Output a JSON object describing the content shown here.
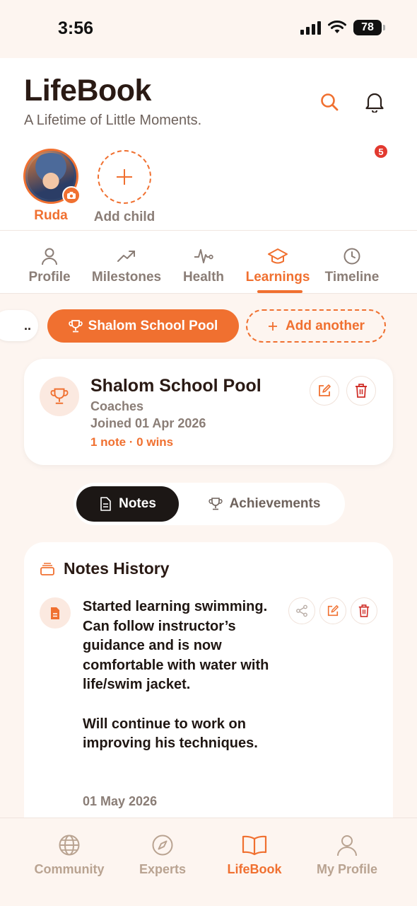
{
  "status_bar": {
    "time": "3:56",
    "battery": "78"
  },
  "header": {
    "title": "LifeBook",
    "subtitle": "A Lifetime of Little Moments.",
    "notification_count": "5"
  },
  "children": {
    "selected_name": "Ruda",
    "add_label": "Add child"
  },
  "tabs": [
    {
      "label": "Profile",
      "icon": "person-icon"
    },
    {
      "label": "Milestones",
      "icon": "trend-icon"
    },
    {
      "label": "Health",
      "icon": "pulse-icon"
    },
    {
      "label": "Learnings",
      "icon": "graduation-cap-icon",
      "active": true
    },
    {
      "label": "Timeline",
      "icon": "clock-icon"
    }
  ],
  "chips": {
    "more": "..",
    "active": "Shalom School Pool",
    "add": "Add another"
  },
  "club": {
    "name": "Shalom School Pool",
    "role": "Coaches",
    "joined": "Joined 01 Apr 2026",
    "stats": "1 note · 0 wins"
  },
  "segment": {
    "notes": "Notes",
    "achievements": "Achievements"
  },
  "notes": {
    "title": "Notes History",
    "items": [
      {
        "text": "Started learning swimming. Can follow instructor’s guidance and is now comfortable with water with life/swim jacket.\n\nWill continue to work on improving his techniques.",
        "date": "01 May 2026"
      }
    ]
  },
  "bottom_nav": [
    {
      "label": "Community",
      "icon": "globe-icon"
    },
    {
      "label": "Experts",
      "icon": "compass-icon"
    },
    {
      "label": "LifeBook",
      "icon": "book-icon",
      "active": true
    },
    {
      "label": "My Profile",
      "icon": "user-icon"
    }
  ],
  "colors": {
    "accent": "#f07030",
    "danger": "#d0302a",
    "background": "#fdf5f0"
  }
}
